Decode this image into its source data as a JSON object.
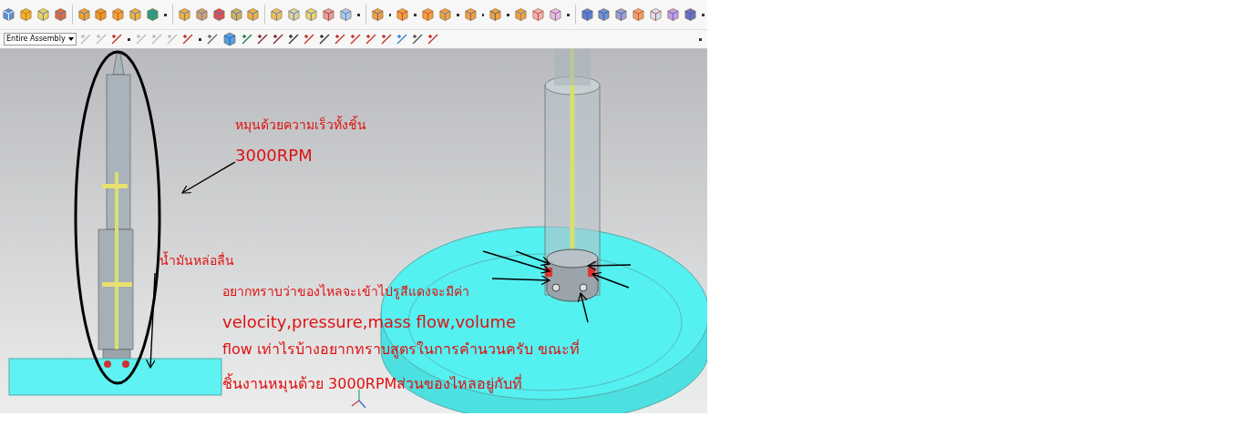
{
  "toolbar": {
    "selection_filter": {
      "value": "Entire Assembly"
    }
  },
  "annotations": [
    {
      "text": "หมุนด้วยความเร็วทั้งชิ้น"
    },
    {
      "text": "3000RPM"
    },
    {
      "text": "น้ำมันหล่อลื่น"
    },
    {
      "text": "อยากทราบว่าของไหลจะเข้าไปรูสีแดงจะมีค่า"
    },
    {
      "text": "velocity,pressure,mass flow,volume"
    },
    {
      "text": "flow เท่าไรบ้างอยากทราบสูตรในการคำนวนครับ ขณะที่"
    },
    {
      "text": "ชิ้นงานหมุนด้วย 3000RPMส่วนของไหลอยู่กับที่"
    }
  ]
}
